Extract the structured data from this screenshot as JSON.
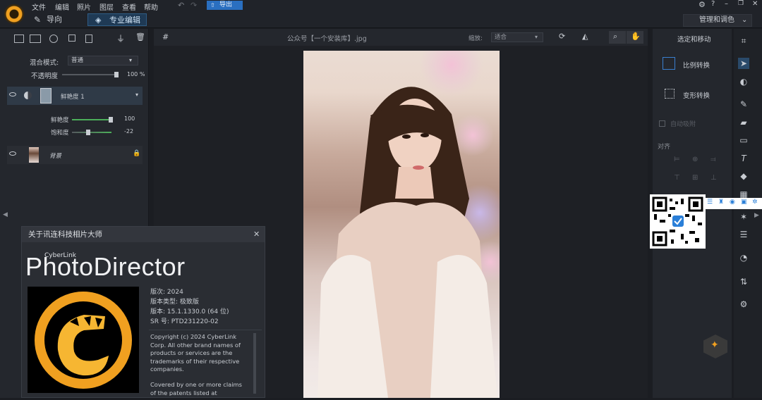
{
  "menu": {
    "file": "文件",
    "edit": "编辑",
    "photo": "照片",
    "layer": "图层",
    "view": "查看",
    "help": "帮助"
  },
  "modes": {
    "guide": "导向",
    "expert": "专业编辑"
  },
  "export_label": "导出",
  "workspace_label": "管理和调色",
  "left": {
    "blend_label": "混合模式:",
    "blend_value": "普通",
    "opacity_label": "不透明度",
    "opacity_value": "100 %",
    "layer1_name": "鲜艳度 1",
    "vib_label": "鲜艳度",
    "vib_value": "100",
    "sat_label": "饱和度",
    "sat_value": "-22",
    "layer2_name": "背景"
  },
  "canvas": {
    "filename": "公众号【一个安装库】.jpg",
    "zoom_label": "缩放:",
    "zoom_value": "适合"
  },
  "right": {
    "header": "选定和移动",
    "proportional": "比例转换",
    "transform": "变形转换",
    "autosnap": "自动吸附",
    "align": "对齐"
  },
  "about": {
    "title": "关于讯连科技相片大师",
    "brand_small": "CyberLink",
    "brand": "PhotoDirector",
    "version_year": "版次: 2024",
    "edition": "版本类型:  极致版",
    "version": "版本:  15.1.1330.0 (64 位)",
    "sr": "SR 号:  PTD231220-02",
    "copyright": "Copyright (c) 2024 CyberLink Corp. All other brand names of products or services are the trademarks of their respective companies.",
    "covered": "Covered by one or more claims of the patents listed at"
  },
  "colors": {
    "accent": "#2a6fc0",
    "logo_orange": "#f0a020"
  }
}
